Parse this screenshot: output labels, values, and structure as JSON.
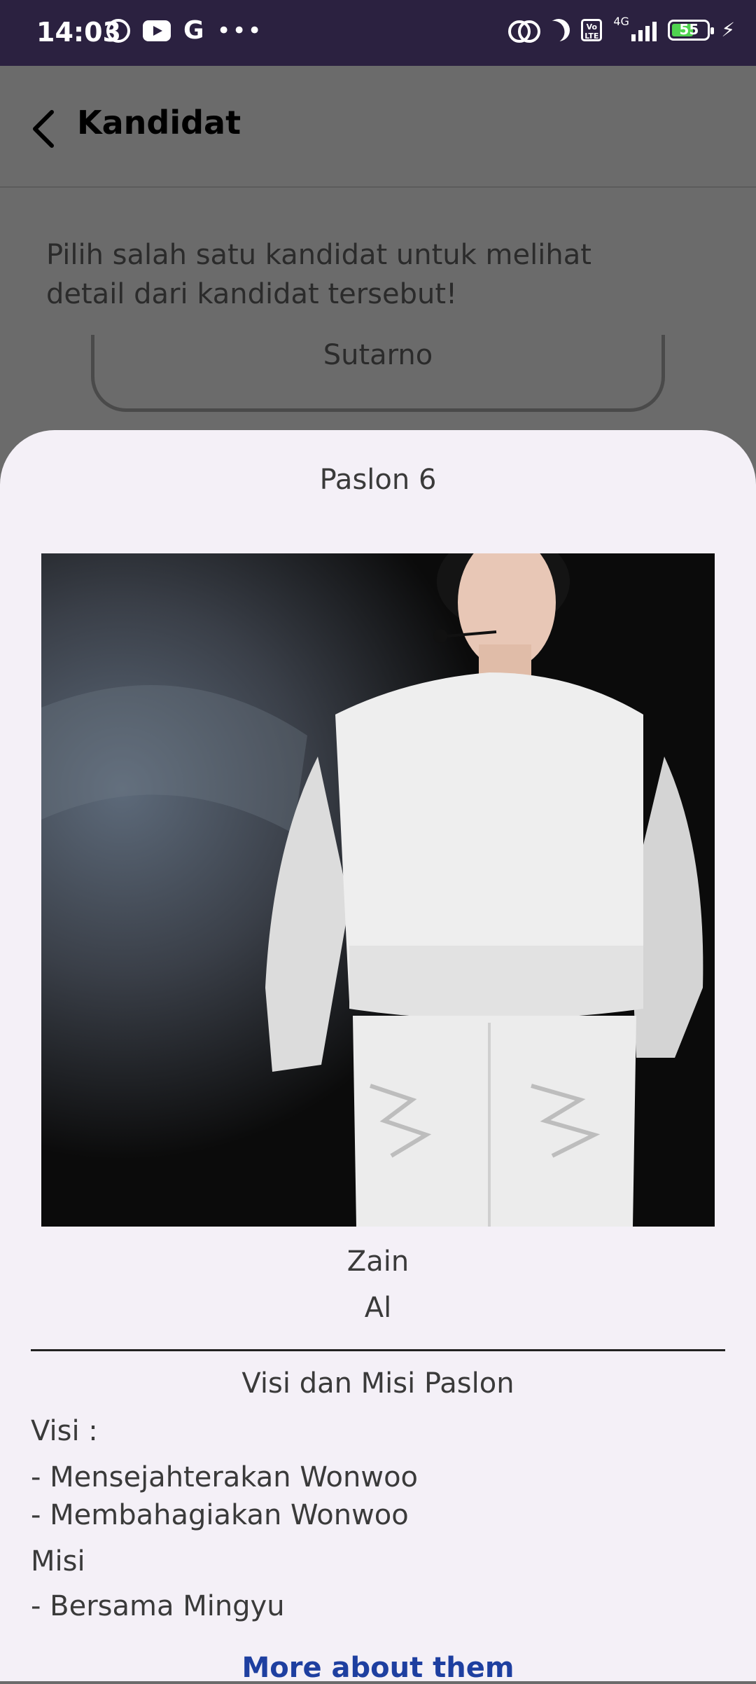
{
  "status_bar": {
    "time": "14:03",
    "network_label": "4G",
    "volte_label": "Vo LTE",
    "battery_level": "55"
  },
  "app_bar": {
    "title": "Kandidat"
  },
  "background_page": {
    "instruction": "Pilih salah satu kandidat untuk melihat detail dari kandidat tersebut!",
    "visible_card_name": "Sutarno"
  },
  "sheet": {
    "title": "Paslon 6",
    "candidate_names": [
      "Zain",
      "Al"
    ],
    "vision_mission_heading": "Visi dan Misi Paslon",
    "visi_label": "Visi :",
    "visi_items": [
      "- Mensejahterakan Wonwoo",
      "- Membahagiakan Wonwoo"
    ],
    "misi_label": "Misi",
    "misi_items": [
      "- Bersama Mingyu"
    ],
    "more_link": "More about them"
  },
  "colors": {
    "status_bar": "#2b2140",
    "sheet_bg": "#f4f0f7",
    "link": "#1e3fa0",
    "scrim": "#6b6b6b"
  }
}
